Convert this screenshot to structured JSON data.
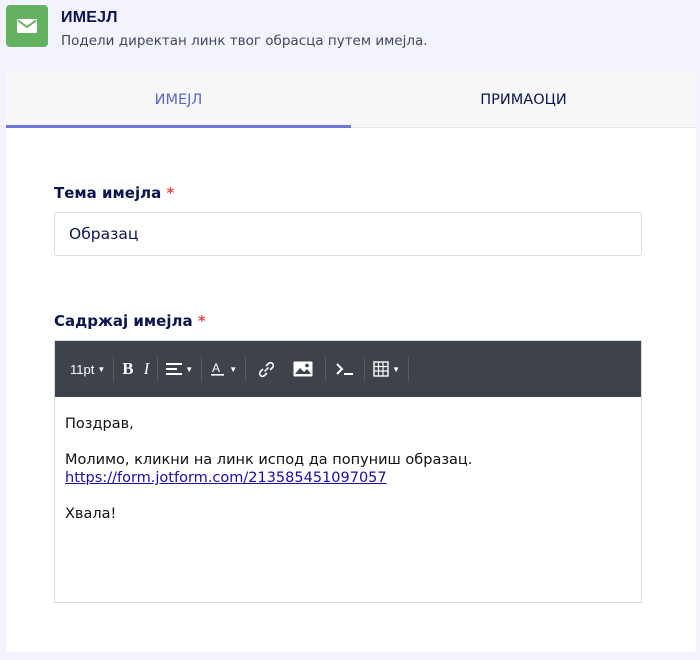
{
  "header": {
    "title": "ИМЕЈЛ",
    "subtitle": "Подели директан линк твог обрасца путем имејла.",
    "icon": "mail-icon",
    "badge_color": "#64b261"
  },
  "tabs": [
    {
      "label": "ИМЕЈЛ",
      "active": true
    },
    {
      "label": "ПРИМАОЦИ",
      "active": false
    }
  ],
  "subject": {
    "label": "Тема имејла",
    "required_mark": "*",
    "value": "Образац"
  },
  "body": {
    "label": "Садржај имејла",
    "required_mark": "*",
    "toolbar": {
      "font_size": "11pt",
      "bold": "B",
      "italic": "I",
      "buttons": [
        "font-size-dropdown",
        "bold-icon",
        "italic-icon",
        "align-icon",
        "text-color-icon",
        "link-icon",
        "image-icon",
        "form-field-icon",
        "table-icon"
      ]
    },
    "greeting": "Поздрав,",
    "message": "Молимо, кликни на линк испод да попуниш образац.",
    "link": "https://form.jotform.com/213585451097057",
    "closing": "Хвала!"
  },
  "colors": {
    "accent": "#6f76d9",
    "required": "#e04b4b",
    "toolbar": "#3e424b"
  }
}
